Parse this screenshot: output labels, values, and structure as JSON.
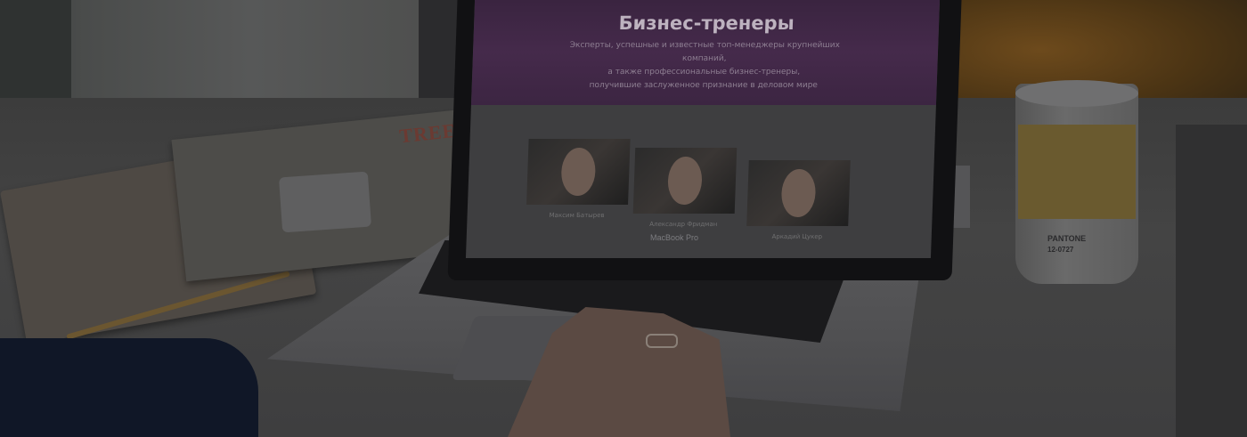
{
  "screen": {
    "title": "Бизнес-тренеры",
    "subtitle_lines": [
      "Эксперты, успешные и известные топ-менеджеры крупнейших компаний,",
      "а также профессиональные бизнес-тренеры,",
      "получившие заслуженное признание в деловом мире"
    ],
    "trainers": [
      {
        "name": "Максим Батырев"
      },
      {
        "name": "Александр Фридман"
      },
      {
        "name": "Аркадий Цукер"
      }
    ]
  },
  "laptop": {
    "brand": "MacBook Pro"
  },
  "book": {
    "title": "TREE"
  },
  "cup": {
    "brand": "PANTONE",
    "code": "12-0727"
  }
}
